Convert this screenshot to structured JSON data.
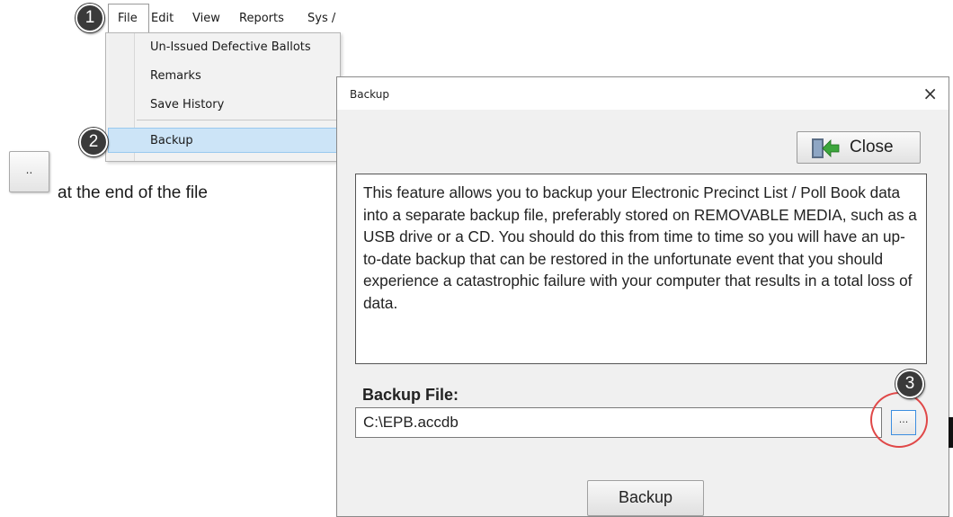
{
  "menubar": {
    "items": [
      "File",
      "Edit",
      "View",
      "Reports",
      "Sys /"
    ]
  },
  "file_menu": {
    "items": [
      "Un-Issued Defective Ballots",
      "Remarks",
      "Save History",
      "Backup"
    ],
    "highlighted": "Backup"
  },
  "callouts": [
    "1",
    "2",
    "3"
  ],
  "left_panel": {
    "button_label": "..",
    "caption": "at the end of the file"
  },
  "dialog": {
    "title": "Backup",
    "close_x": "×",
    "close_button_label": "Close",
    "description": "This feature allows you to backup your Electronic Precinct List / Poll Book data into a separate backup file, preferably stored on REMOVABLE MEDIA, such as a USB drive or a CD. You should do this from time to time so you will have an up-to-date backup that can be restored in the unfortunate event that you should experience a catastrophic failure with your computer that results in a total loss of data.",
    "backup_file_label": "Backup File:",
    "backup_file_value": "C:\\EPB.accdb",
    "browse_button_label": "...",
    "backup_button_label": "Backup"
  },
  "colors": {
    "highlight": "#cce4f7",
    "callout_ring": "#e04848",
    "callout_badge": "#3a3a3a"
  }
}
